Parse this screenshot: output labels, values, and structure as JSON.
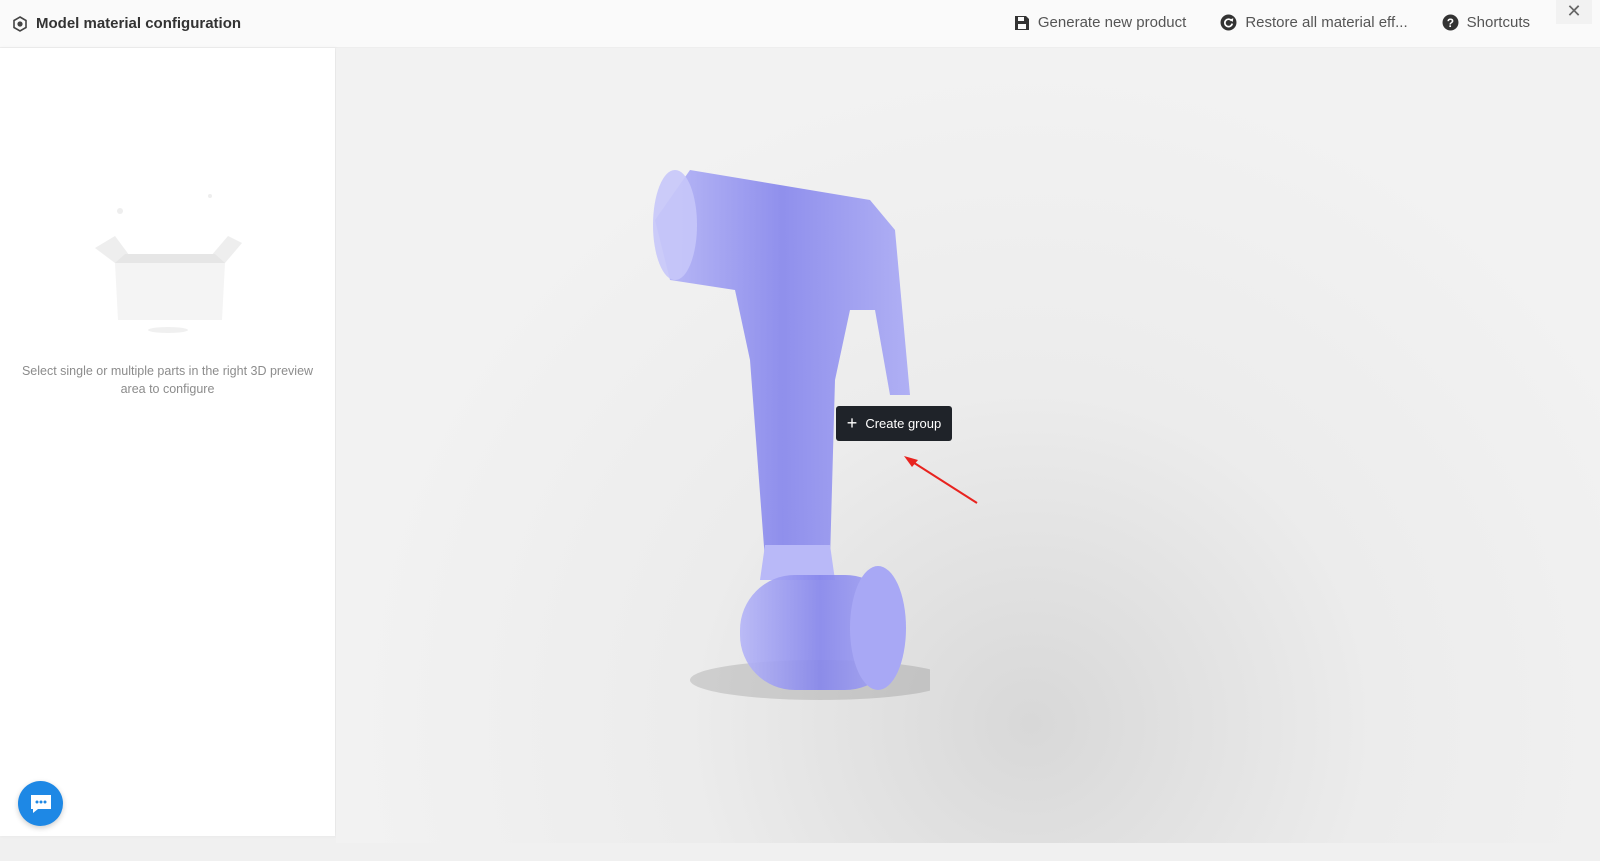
{
  "header": {
    "title": "Model material configuration",
    "generate_label": "Generate new product",
    "restore_label": "Restore all material eff...",
    "shortcuts_label": "Shortcuts",
    "close_label": "✕"
  },
  "left_panel": {
    "empty_text": "Select single or multiple parts in the right 3D preview area to configure"
  },
  "viewport": {
    "tooltip_label": "Create group",
    "model_color": "#8e8ef0",
    "arrow_color": "#e8231f"
  }
}
